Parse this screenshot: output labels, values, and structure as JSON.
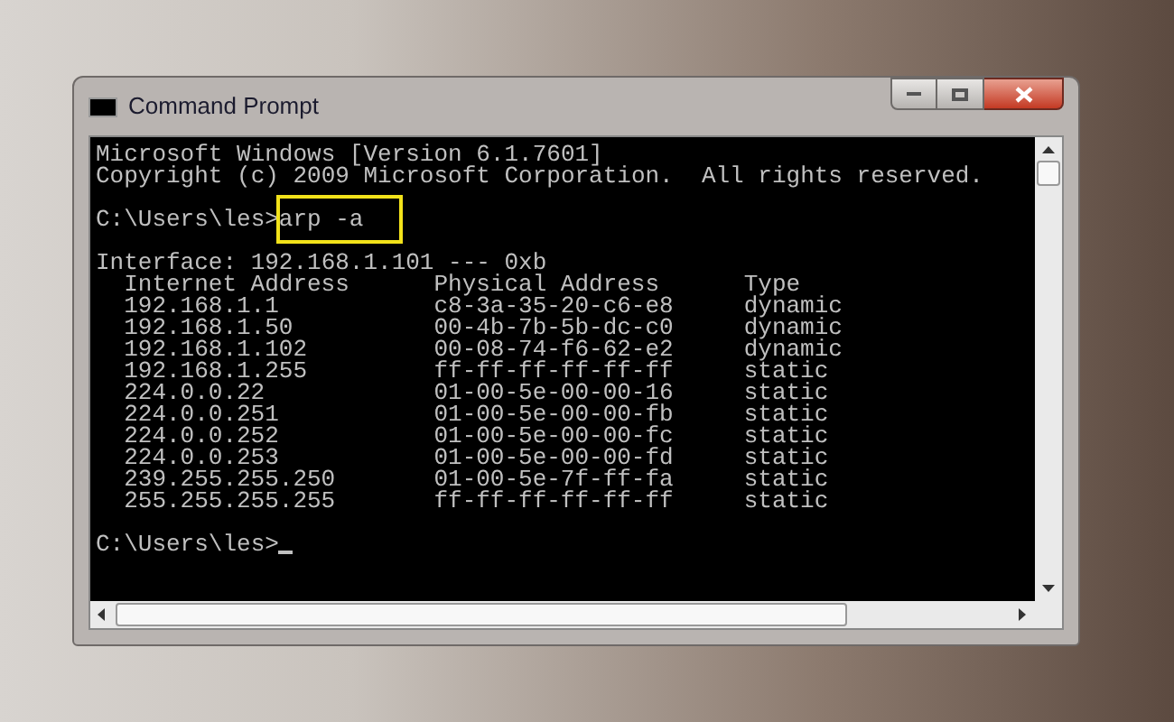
{
  "window": {
    "title": "Command Prompt"
  },
  "console": {
    "banner": [
      "Microsoft Windows [Version 6.1.7601]",
      "Copyright (c) 2009 Microsoft Corporation.  All rights reserved."
    ],
    "command": {
      "prompt": "C:\\Users\\les>",
      "text": "arp -a",
      "highlighted": true
    },
    "interface": "Interface: 192.168.1.101 --- 0xb",
    "columns": [
      "Internet Address",
      "Physical Address",
      "Type"
    ],
    "rows": [
      [
        "192.168.1.1",
        "c8-3a-35-20-c6-e8",
        "dynamic"
      ],
      [
        "192.168.1.50",
        "00-4b-7b-5b-dc-c0",
        "dynamic"
      ],
      [
        "192.168.1.102",
        "00-08-74-f6-62-e2",
        "dynamic"
      ],
      [
        "192.168.1.255",
        "ff-ff-ff-ff-ff-ff",
        "static"
      ],
      [
        "224.0.0.22",
        "01-00-5e-00-00-16",
        "static"
      ],
      [
        "224.0.0.251",
        "01-00-5e-00-00-fb",
        "static"
      ],
      [
        "224.0.0.252",
        "01-00-5e-00-00-fc",
        "static"
      ],
      [
        "224.0.0.253",
        "01-00-5e-00-00-fd",
        "static"
      ],
      [
        "239.255.255.250",
        "01-00-5e-7f-ff-fa",
        "static"
      ],
      [
        "255.255.255.255",
        "ff-ff-ff-ff-ff-ff",
        "static"
      ]
    ],
    "final_prompt": "C:\\Users\\les>"
  }
}
